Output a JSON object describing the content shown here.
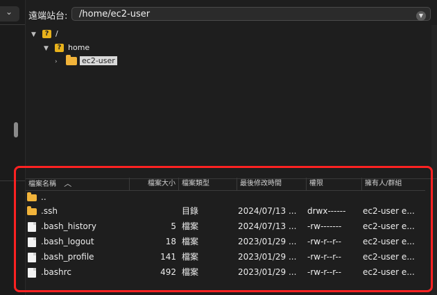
{
  "remote": {
    "label": "遠端站台:",
    "path": "/home/ec2-user",
    "dropdown_icon": "chevron-down-icon"
  },
  "tree": [
    {
      "label": "/",
      "icon": "question-folder-icon",
      "expanded": true
    },
    {
      "label": "home",
      "icon": "question-folder-icon",
      "expanded": true
    },
    {
      "label": "ec2-user",
      "icon": "folder-icon",
      "expanded": false,
      "selected": true
    }
  ],
  "list": {
    "headers": [
      "檔案名稱",
      "檔案大小",
      "檔案類型",
      "最後修改時間",
      "權限",
      "擁有人/群組"
    ],
    "sort_indicator": "^",
    "rows": [
      {
        "icon": "folder-icon",
        "name": "..",
        "size": "",
        "type": "",
        "modified": "",
        "perms": "",
        "owner": ""
      },
      {
        "icon": "folder-icon",
        "name": ".ssh",
        "size": "",
        "type": "目錄",
        "modified": "2024/07/13 ...",
        "perms": "drwx------",
        "owner": "ec2-user e..."
      },
      {
        "icon": "file-icon",
        "name": ".bash_history",
        "size": "5",
        "type": "檔案",
        "modified": "2024/07/13 ...",
        "perms": "-rw-------",
        "owner": "ec2-user e..."
      },
      {
        "icon": "file-icon",
        "name": ".bash_logout",
        "size": "18",
        "type": "檔案",
        "modified": "2023/01/29 ...",
        "perms": "-rw-r--r--",
        "owner": "ec2-user e..."
      },
      {
        "icon": "file-icon",
        "name": ".bash_profile",
        "size": "141",
        "type": "檔案",
        "modified": "2023/01/29 ...",
        "perms": "-rw-r--r--",
        "owner": "ec2-user e..."
      },
      {
        "icon": "file-icon",
        "name": ".bashrc",
        "size": "492",
        "type": "檔案",
        "modified": "2023/01/29 ...",
        "perms": "-rw-r--r--",
        "owner": "ec2-user e..."
      }
    ]
  },
  "colors": {
    "background": "#1e1e1e",
    "highlight_border": "#ff2222",
    "folder": "#f1b33a",
    "question_folder": "#e8b21b"
  }
}
